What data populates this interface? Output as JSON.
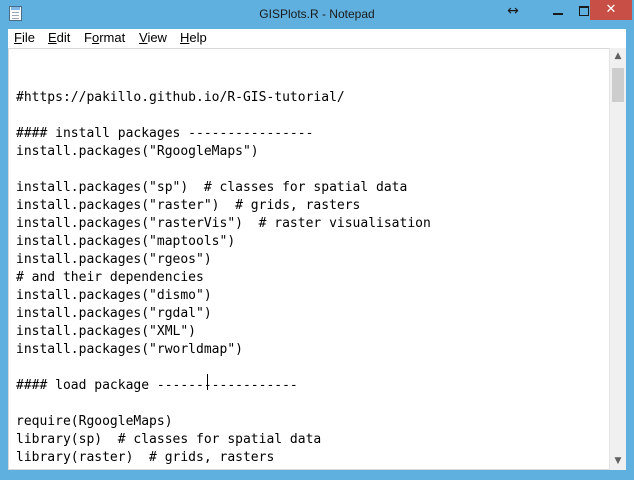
{
  "window": {
    "title": "GISPlots.R - Notepad",
    "close_glyph": "✕",
    "resize_glyph": "↔"
  },
  "menu": [
    {
      "key": "F",
      "rest": "ile"
    },
    {
      "key": "E",
      "rest": "dit"
    },
    {
      "key": "",
      "rest": "Format"
    },
    {
      "key": "V",
      "rest": "iew"
    },
    {
      "key": "H",
      "rest": "elp"
    }
  ],
  "menu_format_underline": "o",
  "editor": {
    "lines": [
      "#https://pakillo.github.io/R-GIS-tutorial/",
      "",
      "#### install packages ----------------",
      "install.packages(\"RgoogleMaps\")",
      "",
      "install.packages(\"sp\")  # classes for spatial data",
      "install.packages(\"raster\")  # grids, rasters",
      "install.packages(\"rasterVis\")  # raster visualisation",
      "install.packages(\"maptools\")",
      "install.packages(\"rgeos\")",
      "# and their dependencies",
      "install.packages(\"dismo\")",
      "install.packages(\"rgdal\")",
      "install.packages(\"XML\")",
      "install.packages(\"rworldmap\")",
      "",
      "#### load package ------------------",
      "",
      "require(RgoogleMaps)",
      "library(sp)  # classes for spatial data",
      "library(raster)  # grids, rasters"
    ]
  },
  "scrollbar": {
    "up_glyph": "▲",
    "down_glyph": "▼"
  }
}
